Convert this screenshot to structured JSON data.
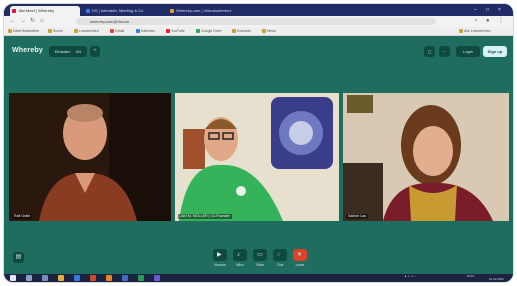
{
  "browser": {
    "tabs": [
      {
        "label": "Jitsi Meet | Whereby",
        "active": true
      },
      {
        "label": "US | Interaktiv, Meeting & Co",
        "active": false
      },
      {
        "label": "Whereby.com | Videokonferenz",
        "active": false
      }
    ],
    "url": "whereby.com/jlrt/room",
    "bookmarks": [
      "Datei Bearbeiten",
      "Suche",
      "Lesezeichen",
      "Gmail",
      "Kalender",
      "YouTube",
      "Google Drive",
      "Kontakte",
      "News",
      "Alle Lesezeichen"
    ]
  },
  "header": {
    "logo": "Whereby",
    "invite_label": "Einladen",
    "people_count": "3/4",
    "plus_label": "+",
    "login_label": "Login",
    "signup_label": "Sign up"
  },
  "participants": [
    {
      "name": "Ralf Gräfe",
      "bg": "#3b2416"
    },
    {
      "name": "JAN M. MÖLLER | Co-Founder",
      "bg": "#e8e2d3"
    },
    {
      "name": "Sabine Lau",
      "bg": "#c9b6a2"
    }
  ],
  "controls": [
    {
      "label": "Kamera",
      "icon": "camera-icon"
    },
    {
      "label": "Mikro",
      "icon": "microphone-icon"
    },
    {
      "label": "Teilen",
      "icon": "screen-share-icon"
    },
    {
      "label": "Chat",
      "icon": "chat-icon"
    },
    {
      "label": "Leave",
      "icon": "leave-icon"
    }
  ],
  "taskbar": {
    "time": "12:04",
    "date": "01.02.2021"
  },
  "colors": {
    "app_bg": "#1f6d5e",
    "leave": "#d8412a",
    "signup_bg": "#d7f2f4"
  }
}
